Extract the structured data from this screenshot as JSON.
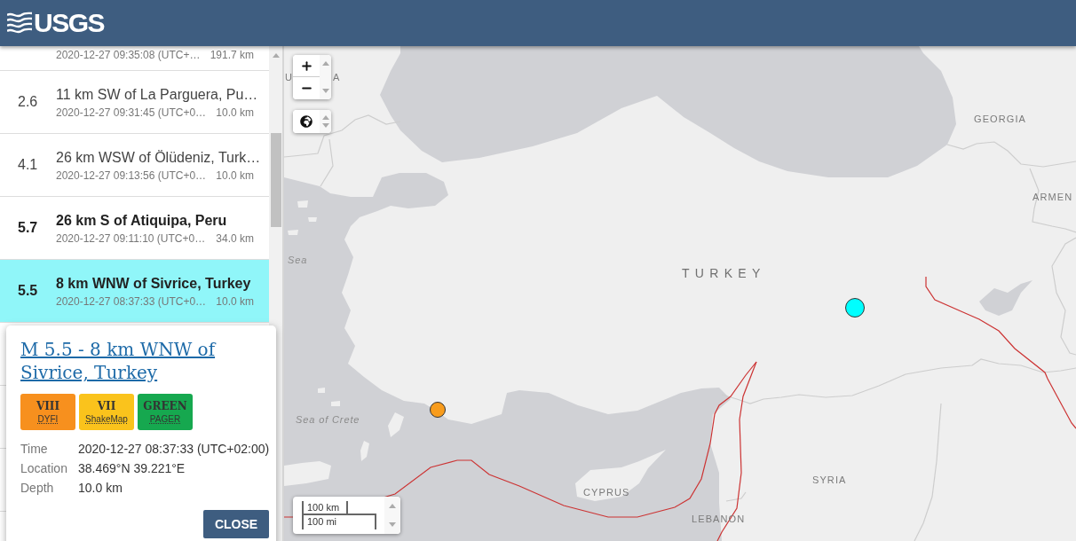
{
  "header": {
    "logo_text": "USGS"
  },
  "event_list": {
    "rows": [
      {
        "time": "2020-12-27 09:35:08 (UTC+…",
        "depth": "191.7 km",
        "selected": false
      },
      {
        "magnitude": "2.6",
        "title": "11 km SW of La Parguera, Pu…",
        "time": "2020-12-27 09:31:45 (UTC+0…",
        "depth": "10.0 km",
        "selected": false,
        "bold": false
      },
      {
        "magnitude": "4.1",
        "title": "26 km WSW of Ölüdeniz, Turk…",
        "time": "2020-12-27 09:13:56 (UTC+0…",
        "depth": "10.0 km",
        "selected": false,
        "bold": false
      },
      {
        "magnitude": "5.7",
        "title": "26 km S of Atiquipa, Peru",
        "time": "2020-12-27 09:11:10 (UTC+0…",
        "depth": "34.0 km",
        "selected": false,
        "bold": true
      },
      {
        "magnitude": "5.5",
        "title": "8 km WNW of Sivrice, Turkey",
        "time": "2020-12-27 08:37:33 (UTC+0…",
        "depth": "10.0 km",
        "selected": true,
        "bold": true
      }
    ]
  },
  "popup": {
    "title": "M 5.5 - 8 km WNW of Sivrice, Turkey",
    "badges": [
      {
        "value": "VIII",
        "label": "DYFI",
        "color": "#f7901e"
      },
      {
        "value": "VII",
        "label": "ShakeMap",
        "color": "#fac31c"
      },
      {
        "value": "GREEN",
        "label": "PAGER",
        "color": "#16a84f"
      }
    ],
    "details": [
      {
        "label": "Time",
        "value": "2020-12-27 08:37:33 (UTC+02:00)"
      },
      {
        "label": "Location",
        "value": "38.469°N 39.221°E"
      },
      {
        "label": "Depth",
        "value": "10.0 km"
      }
    ],
    "close_button": "CLOSE"
  },
  "map": {
    "labels": [
      {
        "text": "U",
        "kind": "country"
      },
      {
        "text": "A",
        "kind": "country"
      },
      {
        "text": "GEORGIA",
        "kind": "country"
      },
      {
        "text": "ARMEN",
        "kind": "country"
      },
      {
        "text": "Sea",
        "kind": "sea"
      },
      {
        "text": "TURKEY",
        "kind": "major_country"
      },
      {
        "text": "Sea of Crete",
        "kind": "sea"
      },
      {
        "text": "SYRIA",
        "kind": "country"
      },
      {
        "text": "CYPRUS",
        "kind": "country"
      },
      {
        "text": "LEBANON",
        "kind": "country"
      }
    ],
    "markers": [
      {
        "color": "#00ffff"
      },
      {
        "color": "#f89c1c"
      }
    ],
    "scale": [
      "100 km",
      "100 mi"
    ]
  }
}
